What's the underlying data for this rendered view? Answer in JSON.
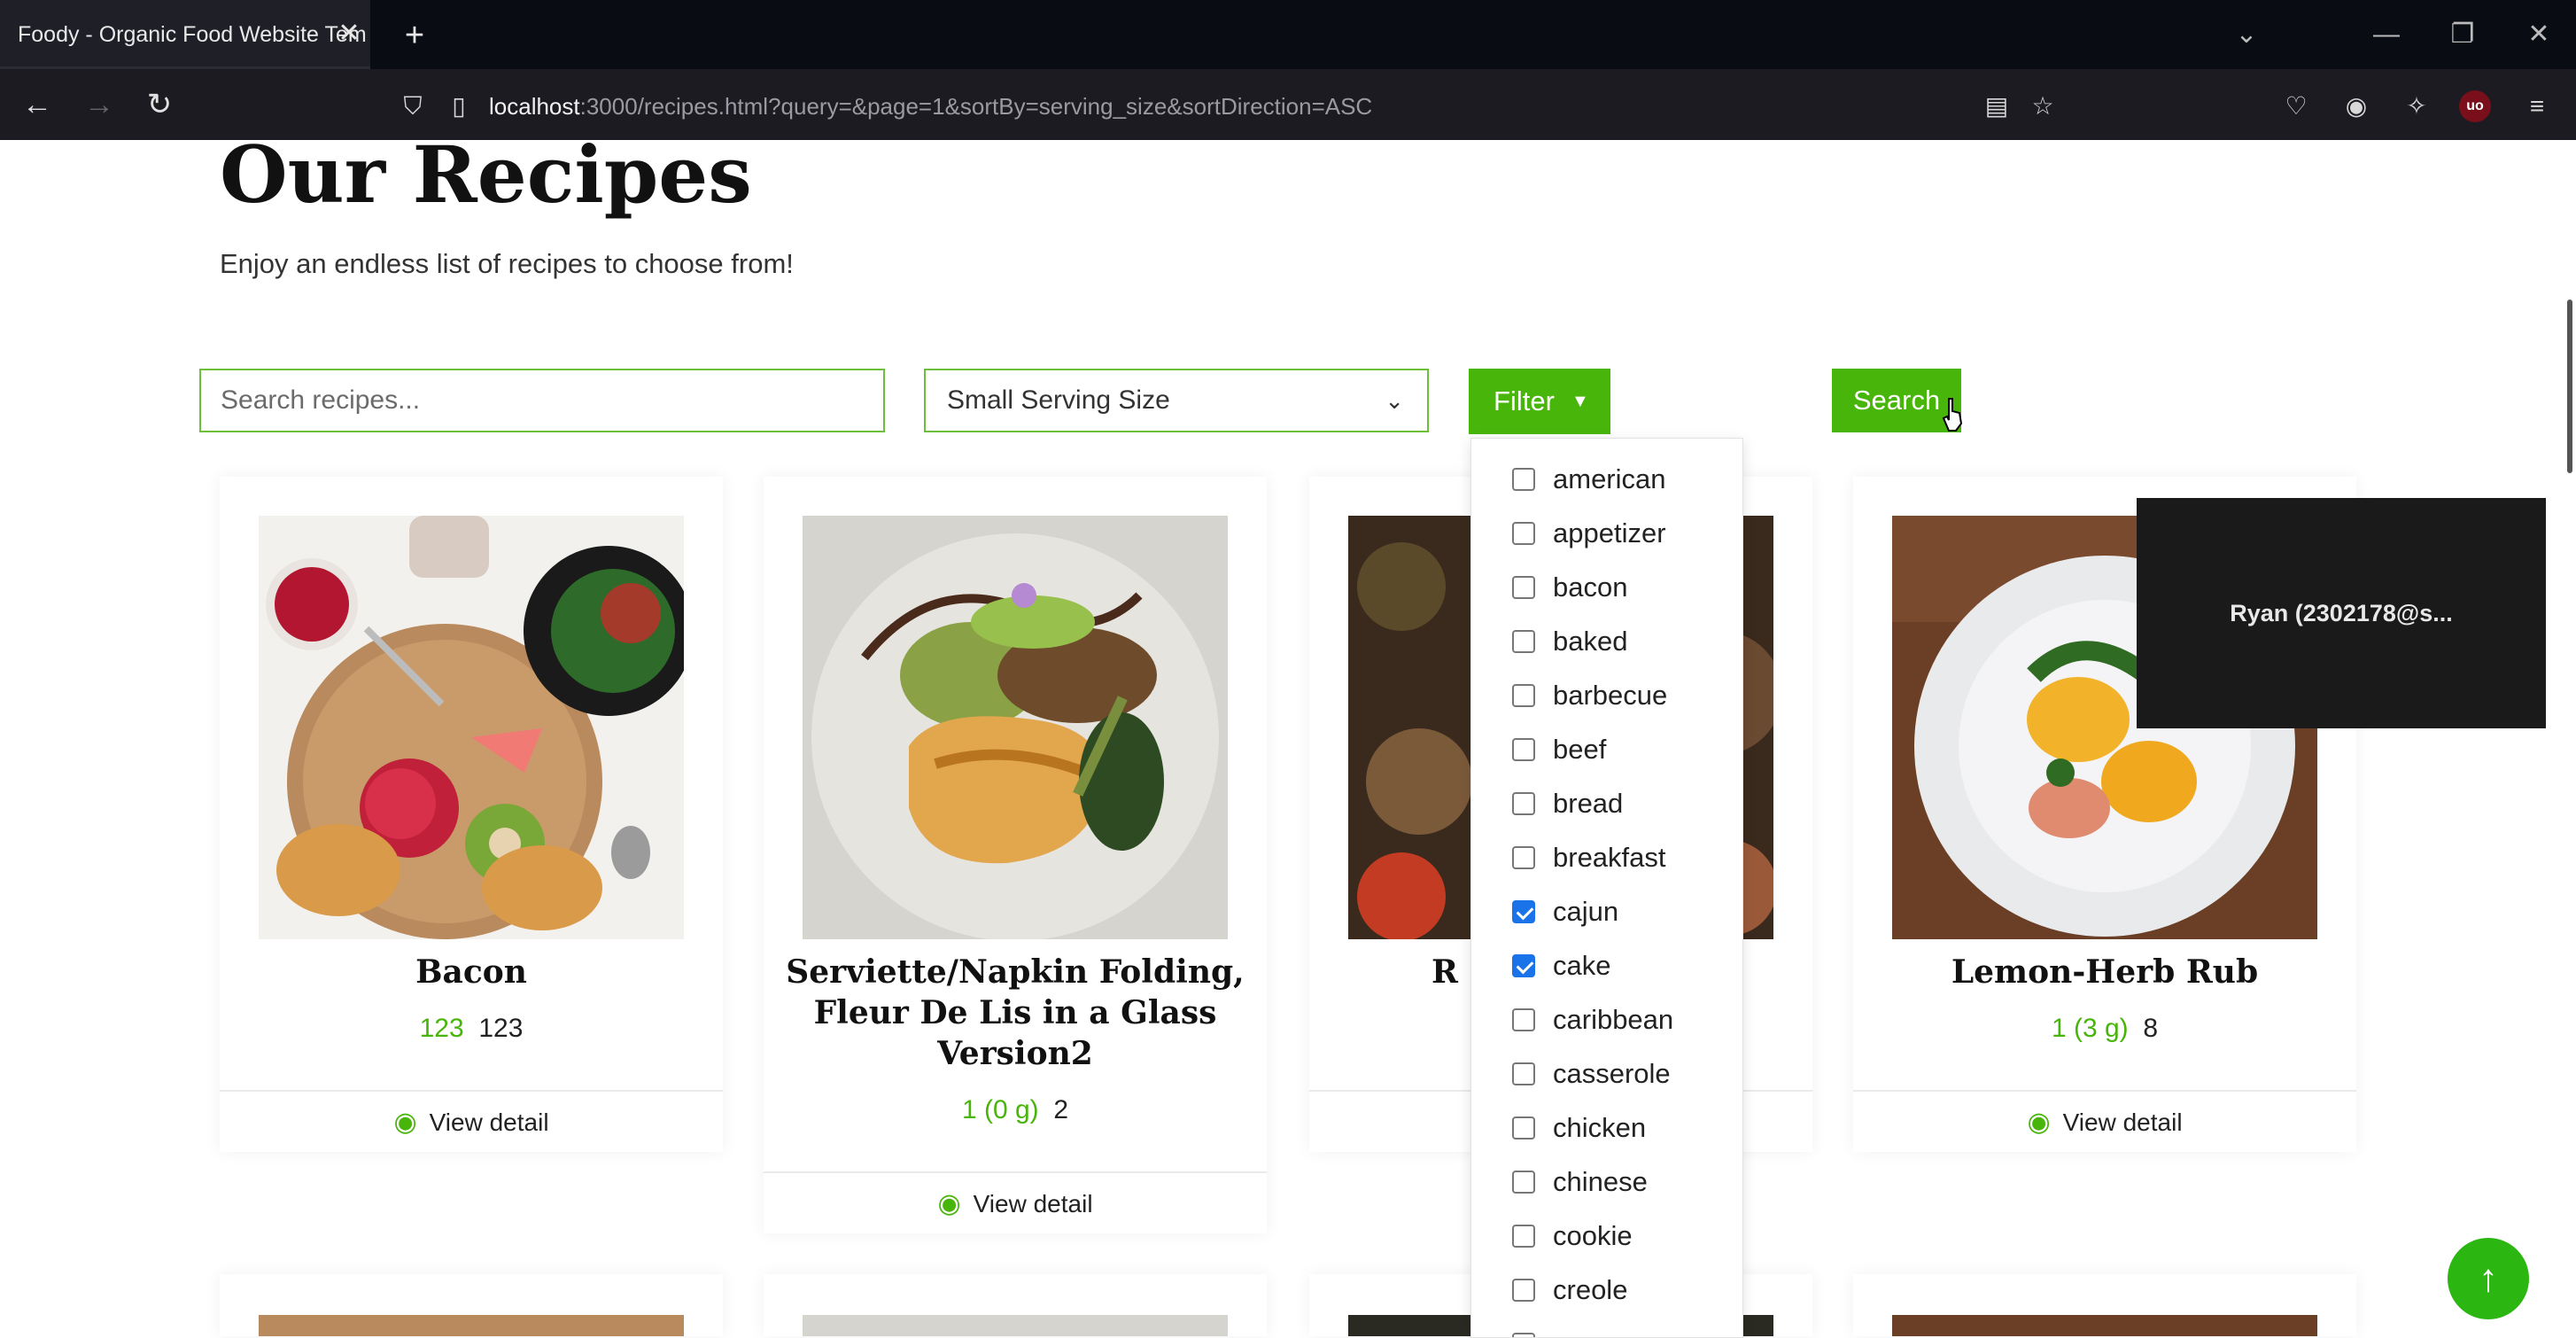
{
  "browser": {
    "tab_title": "Foody - Organic Food Website Tem",
    "tab_close": "✕",
    "new_tab": "+",
    "url_host": "localhost",
    "url_rest": ":3000/recipes.html?query=&page=1&sortBy=serving_size&sortDirection=ASC",
    "extension_badge": "uo"
  },
  "page": {
    "title": "Our Recipes",
    "subtitle": "Enjoy an endless list of recipes to choose from!"
  },
  "search": {
    "placeholder": "Search recipes...",
    "value": ""
  },
  "sort": {
    "selected": "Small Serving Size"
  },
  "filter": {
    "button_label": "Filter",
    "options": [
      {
        "label": "american",
        "checked": false
      },
      {
        "label": "appetizer",
        "checked": false
      },
      {
        "label": "bacon",
        "checked": false
      },
      {
        "label": "baked",
        "checked": false
      },
      {
        "label": "barbecue",
        "checked": false
      },
      {
        "label": "beef",
        "checked": false
      },
      {
        "label": "bread",
        "checked": false
      },
      {
        "label": "breakfast",
        "checked": false
      },
      {
        "label": "cajun",
        "checked": true
      },
      {
        "label": "cake",
        "checked": true
      },
      {
        "label": "caribbean",
        "checked": false
      },
      {
        "label": "casserole",
        "checked": false
      },
      {
        "label": "chicken",
        "checked": false
      },
      {
        "label": "chinese",
        "checked": false
      },
      {
        "label": "cookie",
        "checked": false
      },
      {
        "label": "creole",
        "checked": false
      }
    ]
  },
  "search_button": "Search",
  "recipes": [
    {
      "title": "Bacon",
      "serving": "123",
      "servings_count": "123",
      "view_label": "View detail"
    },
    {
      "title": "Serviette/Napkin Folding, Fleur De Lis in a Glass Version2",
      "serving": "1 (0 g)",
      "servings_count": "2",
      "view_label": "View detail"
    },
    {
      "title": "R",
      "serving": "",
      "servings_count": "",
      "view_label": ""
    },
    {
      "title": "Lemon-Herb Rub",
      "serving": "1 (3 g)",
      "servings_count": "8",
      "view_label": "View detail"
    }
  ],
  "video_overlay": {
    "label": "Ryan  (2302178@s..."
  },
  "colors": {
    "accent": "#48b50b",
    "checkbox_checked": "#1a73e8"
  }
}
